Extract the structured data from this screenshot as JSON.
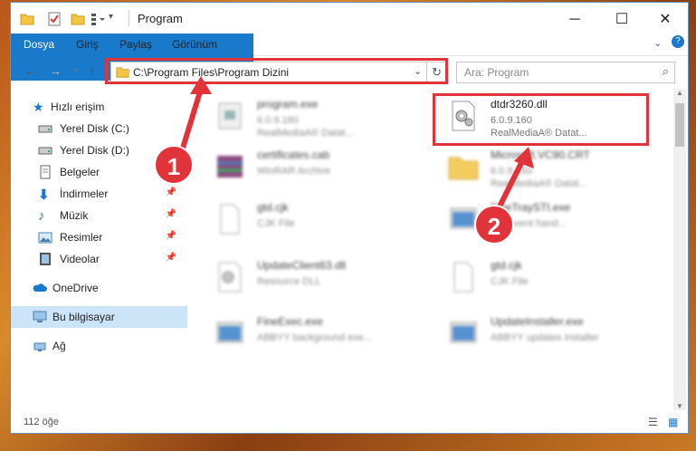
{
  "window": {
    "title": "Program"
  },
  "ribbon": {
    "tabs": [
      "Dosya",
      "Giriş",
      "Paylaş",
      "Görünüm"
    ]
  },
  "address": {
    "path": "C:\\Program Files\\Program Dizini"
  },
  "search": {
    "placeholder": "Ara: Program"
  },
  "sidebar": {
    "items": [
      {
        "label": "Hızlı erişim",
        "icon": "star-icon"
      },
      {
        "label": "Yerel Disk (C:)",
        "icon": "drive-icon"
      },
      {
        "label": "Yerel Disk (D:)",
        "icon": "drive-icon"
      },
      {
        "label": "Belgeler",
        "icon": "document-icon"
      },
      {
        "label": "İndirmeler",
        "icon": "download-icon"
      },
      {
        "label": "Müzik",
        "icon": "music-icon"
      },
      {
        "label": "Resimler",
        "icon": "pictures-icon"
      },
      {
        "label": "Videolar",
        "icon": "video-icon"
      },
      {
        "label": "OneDrive",
        "icon": "cloud-icon"
      },
      {
        "label": "Bu bilgisayar",
        "icon": "computer-icon"
      },
      {
        "label": "Ağ",
        "icon": "network-icon"
      }
    ]
  },
  "files": [
    {
      "name": "program.exe",
      "line1": "6.0.9.160",
      "line2": "RealMediaA® Datat...",
      "blurred": true
    },
    {
      "name": "dtdr3260.dll",
      "line1": "6.0.9.160",
      "line2": "RealMediaA® Datat...",
      "blurred": false
    },
    {
      "name": "certificates.cab",
      "line1": "WinRAR Archive",
      "line2": "",
      "blurred": true
    },
    {
      "name": "Microsoft.VC90.CRT",
      "line1": "6.0.9.160",
      "line2": "RealMediaA® Datat...",
      "blurred": true
    },
    {
      "name": "gtd.cjk",
      "line1": "CJK File",
      "line2": "",
      "blurred": true
    },
    {
      "name": "FineTraySTI.exe",
      "line1": "STI event hand...",
      "line2": "",
      "blurred": true
    },
    {
      "name": "UpdateClient63.dll",
      "line1": "Resource DLL",
      "line2": "",
      "blurred": true
    },
    {
      "name": "gtd.cjk",
      "line1": "CJK File",
      "line2": "",
      "blurred": true
    },
    {
      "name": "FineExec.exe",
      "line1": "ABBYY background exe...",
      "line2": "",
      "blurred": true
    },
    {
      "name": "UpdateInstaller.exe",
      "line1": "ABBYY updates installer",
      "line2": "",
      "blurred": true
    }
  ],
  "status": {
    "count": "112 öğe"
  },
  "annotations": {
    "badge1": "1",
    "badge2": "2"
  },
  "colors": {
    "accent": "#1979ca",
    "highlight": "#e0333a",
    "selection": "#cce4f7"
  }
}
